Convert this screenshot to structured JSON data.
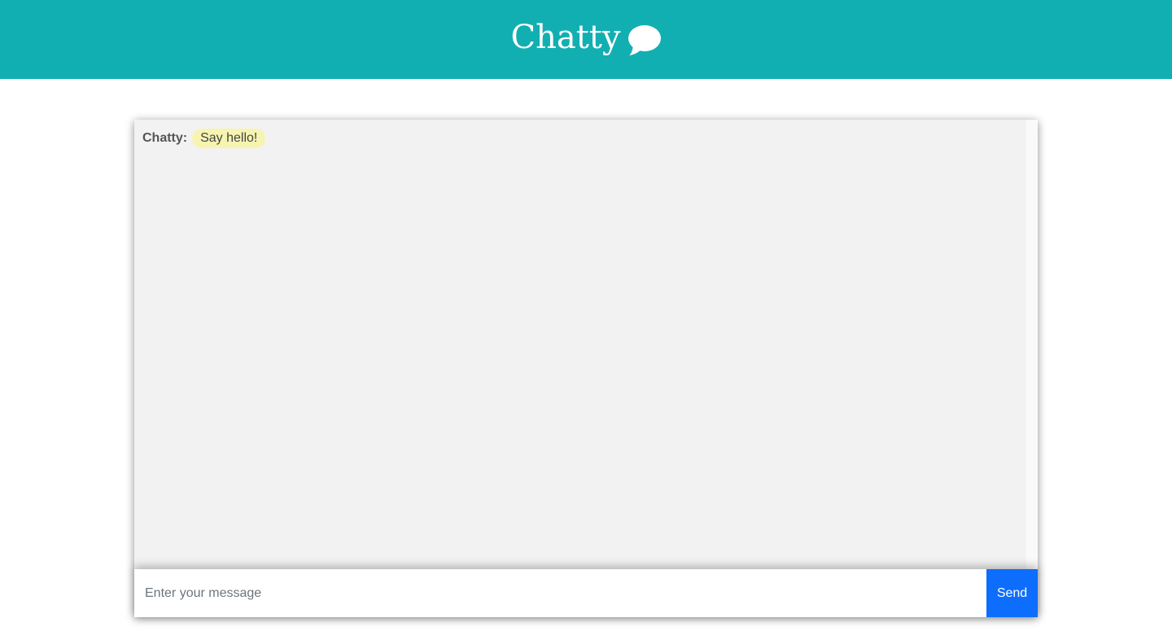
{
  "header": {
    "title": "Chatty",
    "icon": "speech-bubble-icon",
    "background_color": "#12afb2"
  },
  "chat": {
    "messages": [
      {
        "sender": "Chatty:",
        "text": "Say hello!",
        "bubble_color": "#f6f4b0"
      }
    ]
  },
  "composer": {
    "placeholder": "Enter your message",
    "value": "",
    "send_label": "Send",
    "send_color": "#0d6efd"
  }
}
